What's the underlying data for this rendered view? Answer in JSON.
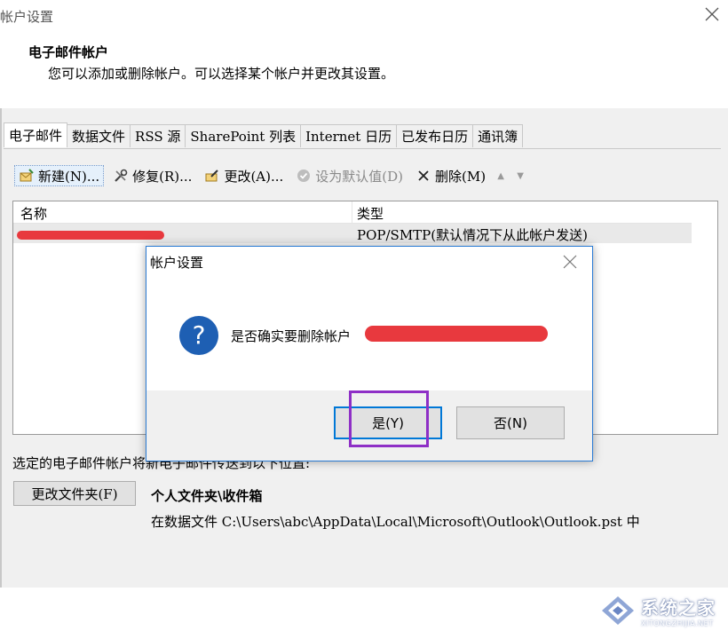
{
  "window": {
    "title": "帐户设置",
    "header_title": "电子邮件帐户",
    "header_subtitle": "您可以添加或删除帐户。可以选择某个帐户并更改其设置。"
  },
  "tabs": [
    "电子邮件",
    "数据文件",
    "RSS 源",
    "SharePoint 列表",
    "Internet 日历",
    "已发布日历",
    "通讯簿"
  ],
  "active_tab": "电子邮件",
  "toolbar": {
    "new_label": "新建(N)...",
    "repair_label": "修复(R)...",
    "change_label": "更改(A)...",
    "default_label": "设为默认值(D)",
    "delete_label": "删除(M)",
    "up_icon": "arrow-up-icon",
    "down_icon": "arrow-down-icon"
  },
  "list": {
    "col_name": "名称",
    "col_type": "类型",
    "rows": [
      {
        "name": "",
        "type": "POP/SMTP(默认情况下从此帐户发送)"
      }
    ]
  },
  "delivery": {
    "label": "选定的电子邮件帐户将新电子邮件传送到以下位置:",
    "change_folder_label": "更改文件夹(F)",
    "folder_name": "个人文件夹\\收件箱",
    "folder_path": "在数据文件 C:\\Users\\abc\\AppData\\Local\\Microsoft\\Outlook\\Outlook.pst 中"
  },
  "dialog": {
    "title": "帐户设置",
    "message": "是否确实要删除帐户",
    "yes_label": "是(Y)",
    "no_label": "否(N)",
    "icon": "question-icon"
  },
  "watermark": {
    "text": "系统之家",
    "subtext": "XITONGZHIJIA.NET"
  },
  "colors": {
    "accent": "#0078d7",
    "highlight": "#8e2fc6",
    "redaction": "#e8393e",
    "question_icon": "#1e5fb3"
  }
}
